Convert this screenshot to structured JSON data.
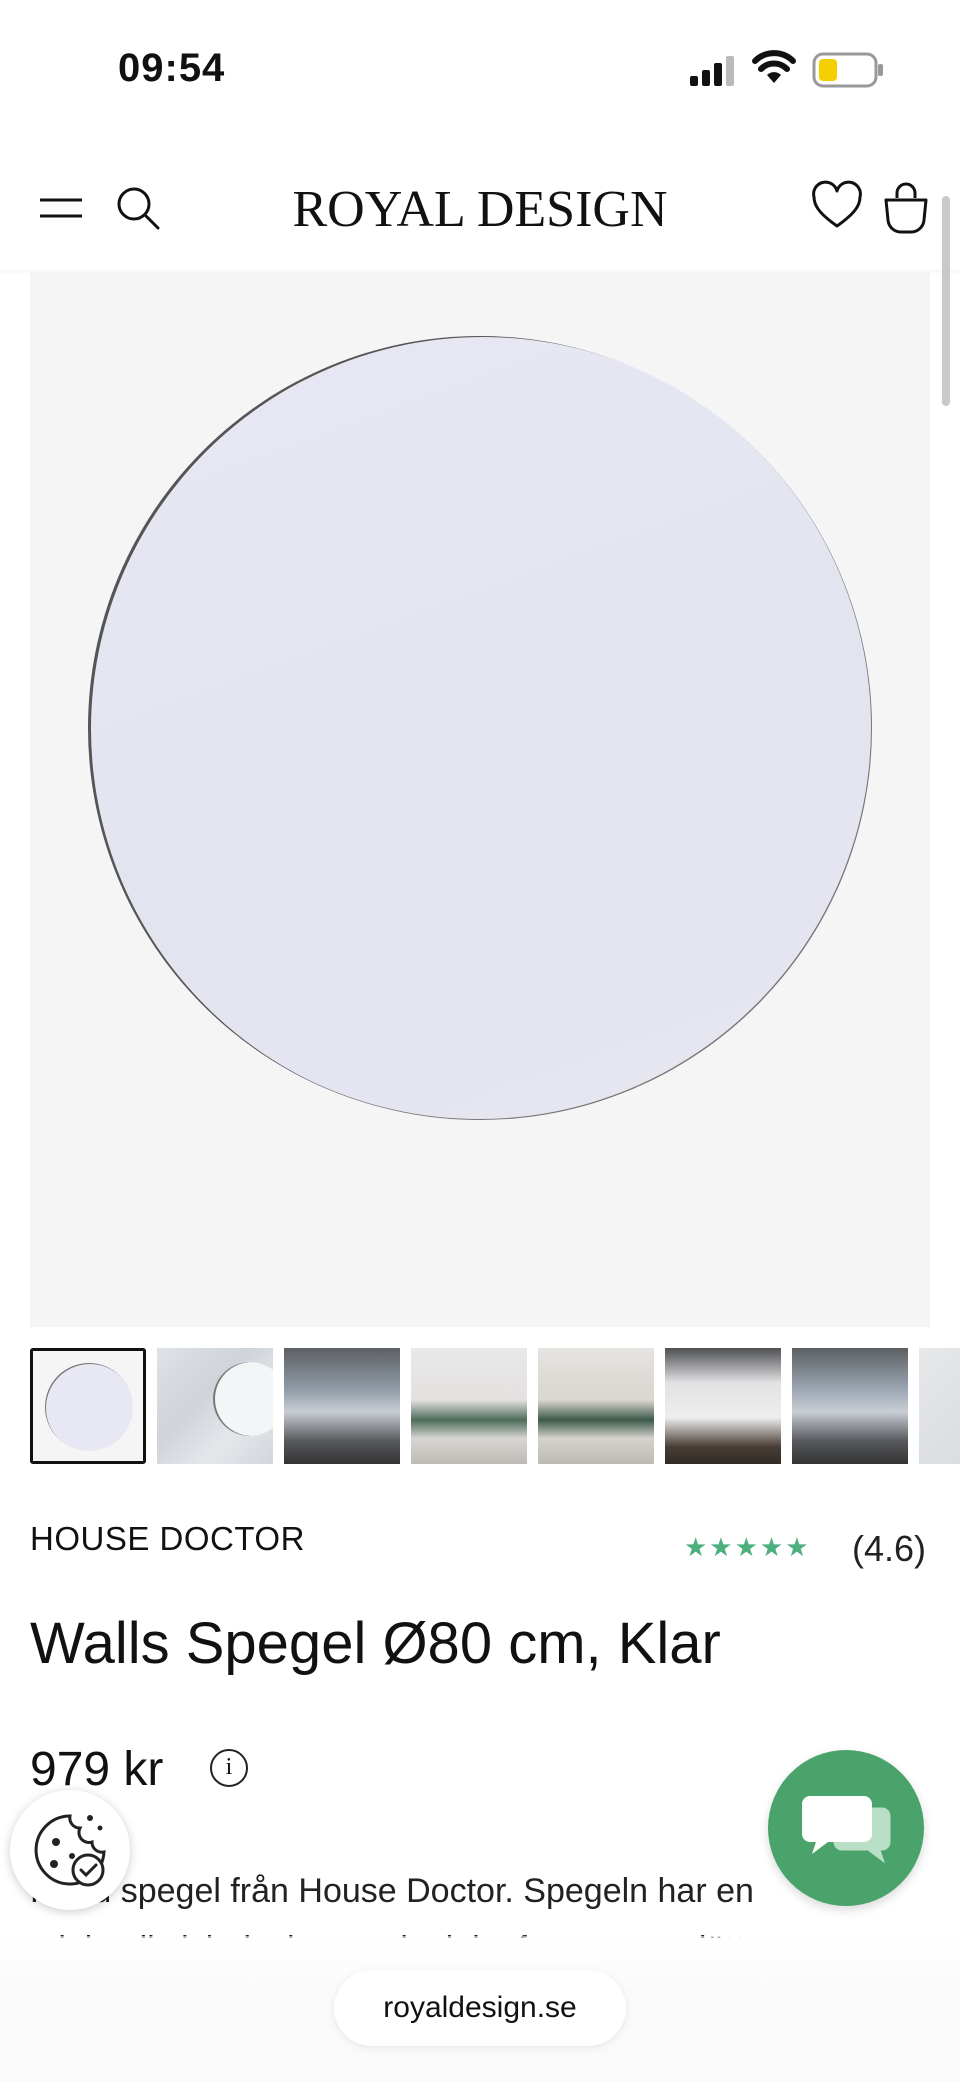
{
  "status_bar": {
    "time": "09:54"
  },
  "header": {
    "logo": "ROYAL DESIGN"
  },
  "gallery": {
    "thumbnails": [
      "mirror",
      "mirror-marble",
      "room-1",
      "living-room-1",
      "living-room-2",
      "desk-room",
      "room-2",
      "marble-2"
    ]
  },
  "product": {
    "brand": "HOUSE DOCTOR",
    "rating_stars": "★★★★★",
    "rating": 4.6,
    "rating_text": "(4.6)",
    "title": "Walls Spegel Ø80 cm, Klar",
    "price": "979 kr",
    "info_icon": "i",
    "description": "Rund spegel från House Doctor. Spegeln har en minimalistisk design med mjuka former som lätt"
  },
  "browser": {
    "url": "royaldesign.se"
  },
  "colors": {
    "rating": "#4caf7d",
    "chat": "#4aa36a"
  }
}
